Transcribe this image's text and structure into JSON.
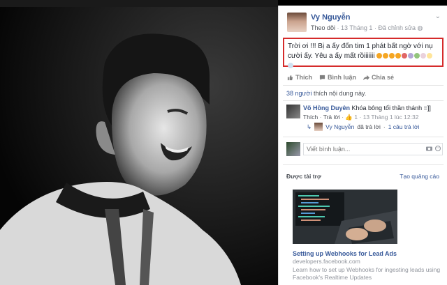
{
  "post": {
    "author": "Vy Nguyễn",
    "follow_label": "Theo dõi",
    "date": "13 Tháng 1",
    "edited_label": "Đã chỉnh sửa",
    "text": "Trời ơi !!! Bị a ấy đốn tim 1 phát bất ngờ với nụ cười ấy. Yêu a ấy mất rồiiiiiii",
    "emoji_colors": [
      "#f5a623",
      "#f5a623",
      "#f5a623",
      "#f5a623",
      "#e06666",
      "#b4a7d6",
      "#93c47d",
      "#ead1dc",
      "#ffe599",
      "#cfe2f3"
    ]
  },
  "actions": {
    "like": "Thích",
    "comment": "Bình luận",
    "share": "Chia sẻ"
  },
  "likes": {
    "count": "38 người",
    "suffix": "thích nội dung này."
  },
  "comment": {
    "author": "Võ Hồng Duyên",
    "text": "Khóa bông tối thần thánh =]]",
    "like": "Thích",
    "reply": "Trả lời",
    "like_count": "1",
    "time": "13 Tháng 1 lúc 12:32"
  },
  "reply": {
    "author": "Vy Nguyễn",
    "mid": "đã trả lời",
    "sep": "·",
    "count": "1 câu trả lời"
  },
  "write": {
    "placeholder": "Viết bình luận..."
  },
  "sponsored": {
    "label": "Được tài trợ",
    "create": "Tạo quảng cáo",
    "title": "Setting up Webhooks for Lead Ads",
    "domain": "developers.facebook.com",
    "desc": "Learn how to set up Webhooks for ingesting leads using Facebook's Realtime Updates"
  },
  "colors": {
    "link": "#365899",
    "highlight_border": "#d52b2b"
  }
}
